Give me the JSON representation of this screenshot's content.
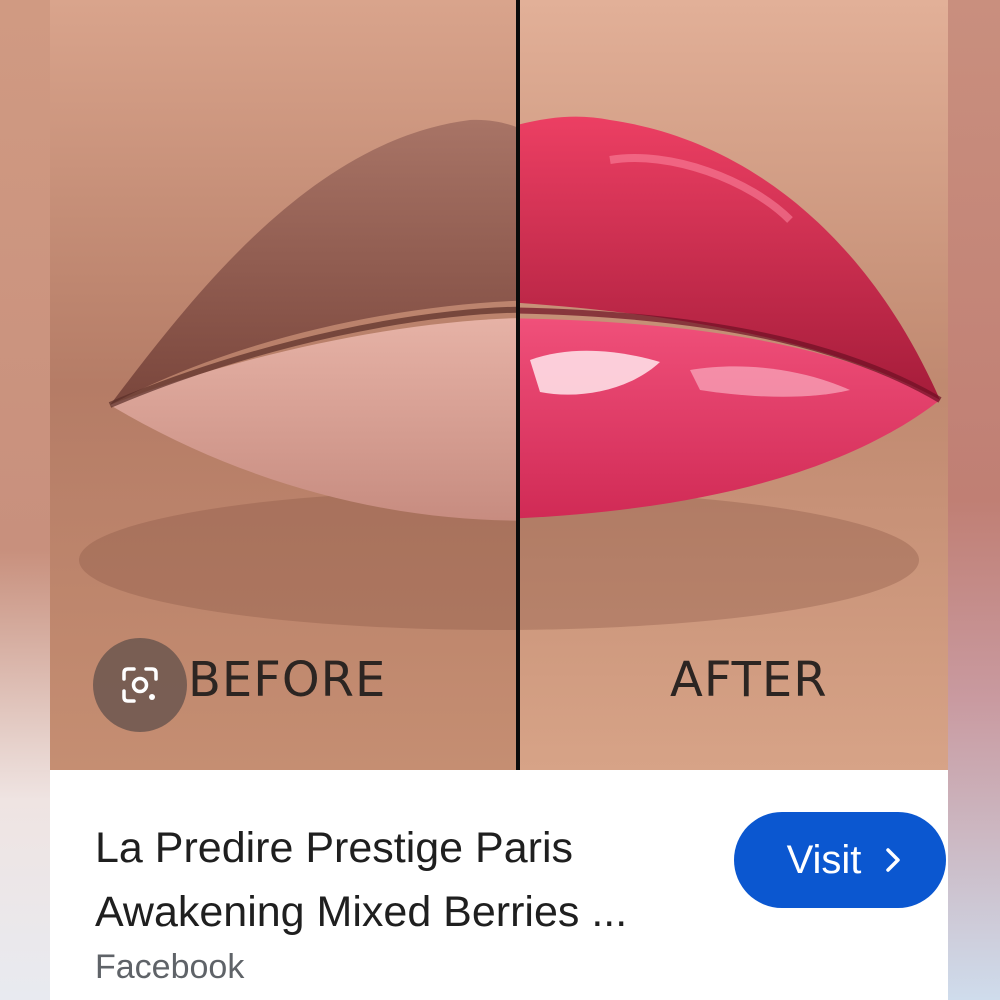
{
  "photo": {
    "before_label": "BEFORE",
    "after_label": "AFTER",
    "lens_icon": "google-lens-icon"
  },
  "result": {
    "title_line1": "La Predire Prestige Paris",
    "title_line2": "Awakening Mixed Berries ...",
    "source": "Facebook",
    "visit_label": "Visit",
    "visit_icon": "chevron-right-icon"
  },
  "colors": {
    "visit_button": "#0b57d0",
    "lip_after": "#e0325a",
    "lip_before": "#a8685d"
  }
}
